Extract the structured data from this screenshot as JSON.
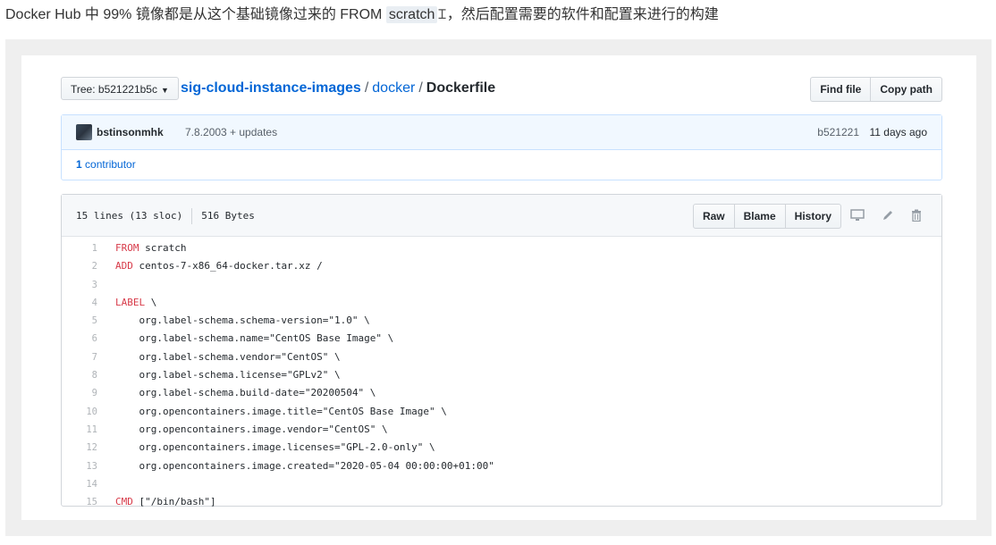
{
  "article": {
    "text_before": "Docker Hub 中 99% 镜像都是从这个基础镜像过来的 FROM ",
    "code": "scratch",
    "text_after": "，然后配置需要的软件和配置来进行的构建"
  },
  "repo": {
    "tree_button": "Tree: b521221b5c",
    "repo_name": "sig-cloud-instance-images",
    "sep1": "/",
    "folder": "docker",
    "sep2": "/",
    "file": "Dockerfile",
    "find_file": "Find file",
    "copy_path": "Copy path"
  },
  "commit": {
    "author": "bstinsonmhk",
    "message": "7.8.2003 + updates",
    "sha": "b521221",
    "age": "11 days ago",
    "contributors_count": "1",
    "contributors_label": "contributor"
  },
  "file": {
    "lines_info": "15 lines (13 sloc)",
    "size": "516 Bytes",
    "raw": "Raw",
    "blame": "Blame",
    "history": "History",
    "lines": [
      {
        "n": "1",
        "kw": "FROM",
        "rest": " scratch"
      },
      {
        "n": "2",
        "kw": "ADD",
        "rest": " centos-7-x86_64-docker.tar.xz /"
      },
      {
        "n": "3",
        "kw": "",
        "rest": ""
      },
      {
        "n": "4",
        "kw": "LABEL",
        "rest": " \\"
      },
      {
        "n": "5",
        "kw": "",
        "rest": "    org.label-schema.schema-version=\"1.0\" \\"
      },
      {
        "n": "6",
        "kw": "",
        "rest": "    org.label-schema.name=\"CentOS Base Image\" \\"
      },
      {
        "n": "7",
        "kw": "",
        "rest": "    org.label-schema.vendor=\"CentOS\" \\"
      },
      {
        "n": "8",
        "kw": "",
        "rest": "    org.label-schema.license=\"GPLv2\" \\"
      },
      {
        "n": "9",
        "kw": "",
        "rest": "    org.label-schema.build-date=\"20200504\" \\"
      },
      {
        "n": "10",
        "kw": "",
        "rest": "    org.opencontainers.image.title=\"CentOS Base Image\" \\"
      },
      {
        "n": "11",
        "kw": "",
        "rest": "    org.opencontainers.image.vendor=\"CentOS\" \\"
      },
      {
        "n": "12",
        "kw": "",
        "rest": "    org.opencontainers.image.licenses=\"GPL-2.0-only\" \\"
      },
      {
        "n": "13",
        "kw": "",
        "rest": "    org.opencontainers.image.created=\"2020-05-04 00:00:00+01:00\""
      },
      {
        "n": "14",
        "kw": "",
        "rest": ""
      },
      {
        "n": "15",
        "kw": "CMD",
        "rest": " [\"/bin/bash\"]"
      }
    ]
  },
  "colors": {
    "link": "#0366d6",
    "keyword": "#d73a49",
    "commit_bg": "#f1f8ff"
  }
}
